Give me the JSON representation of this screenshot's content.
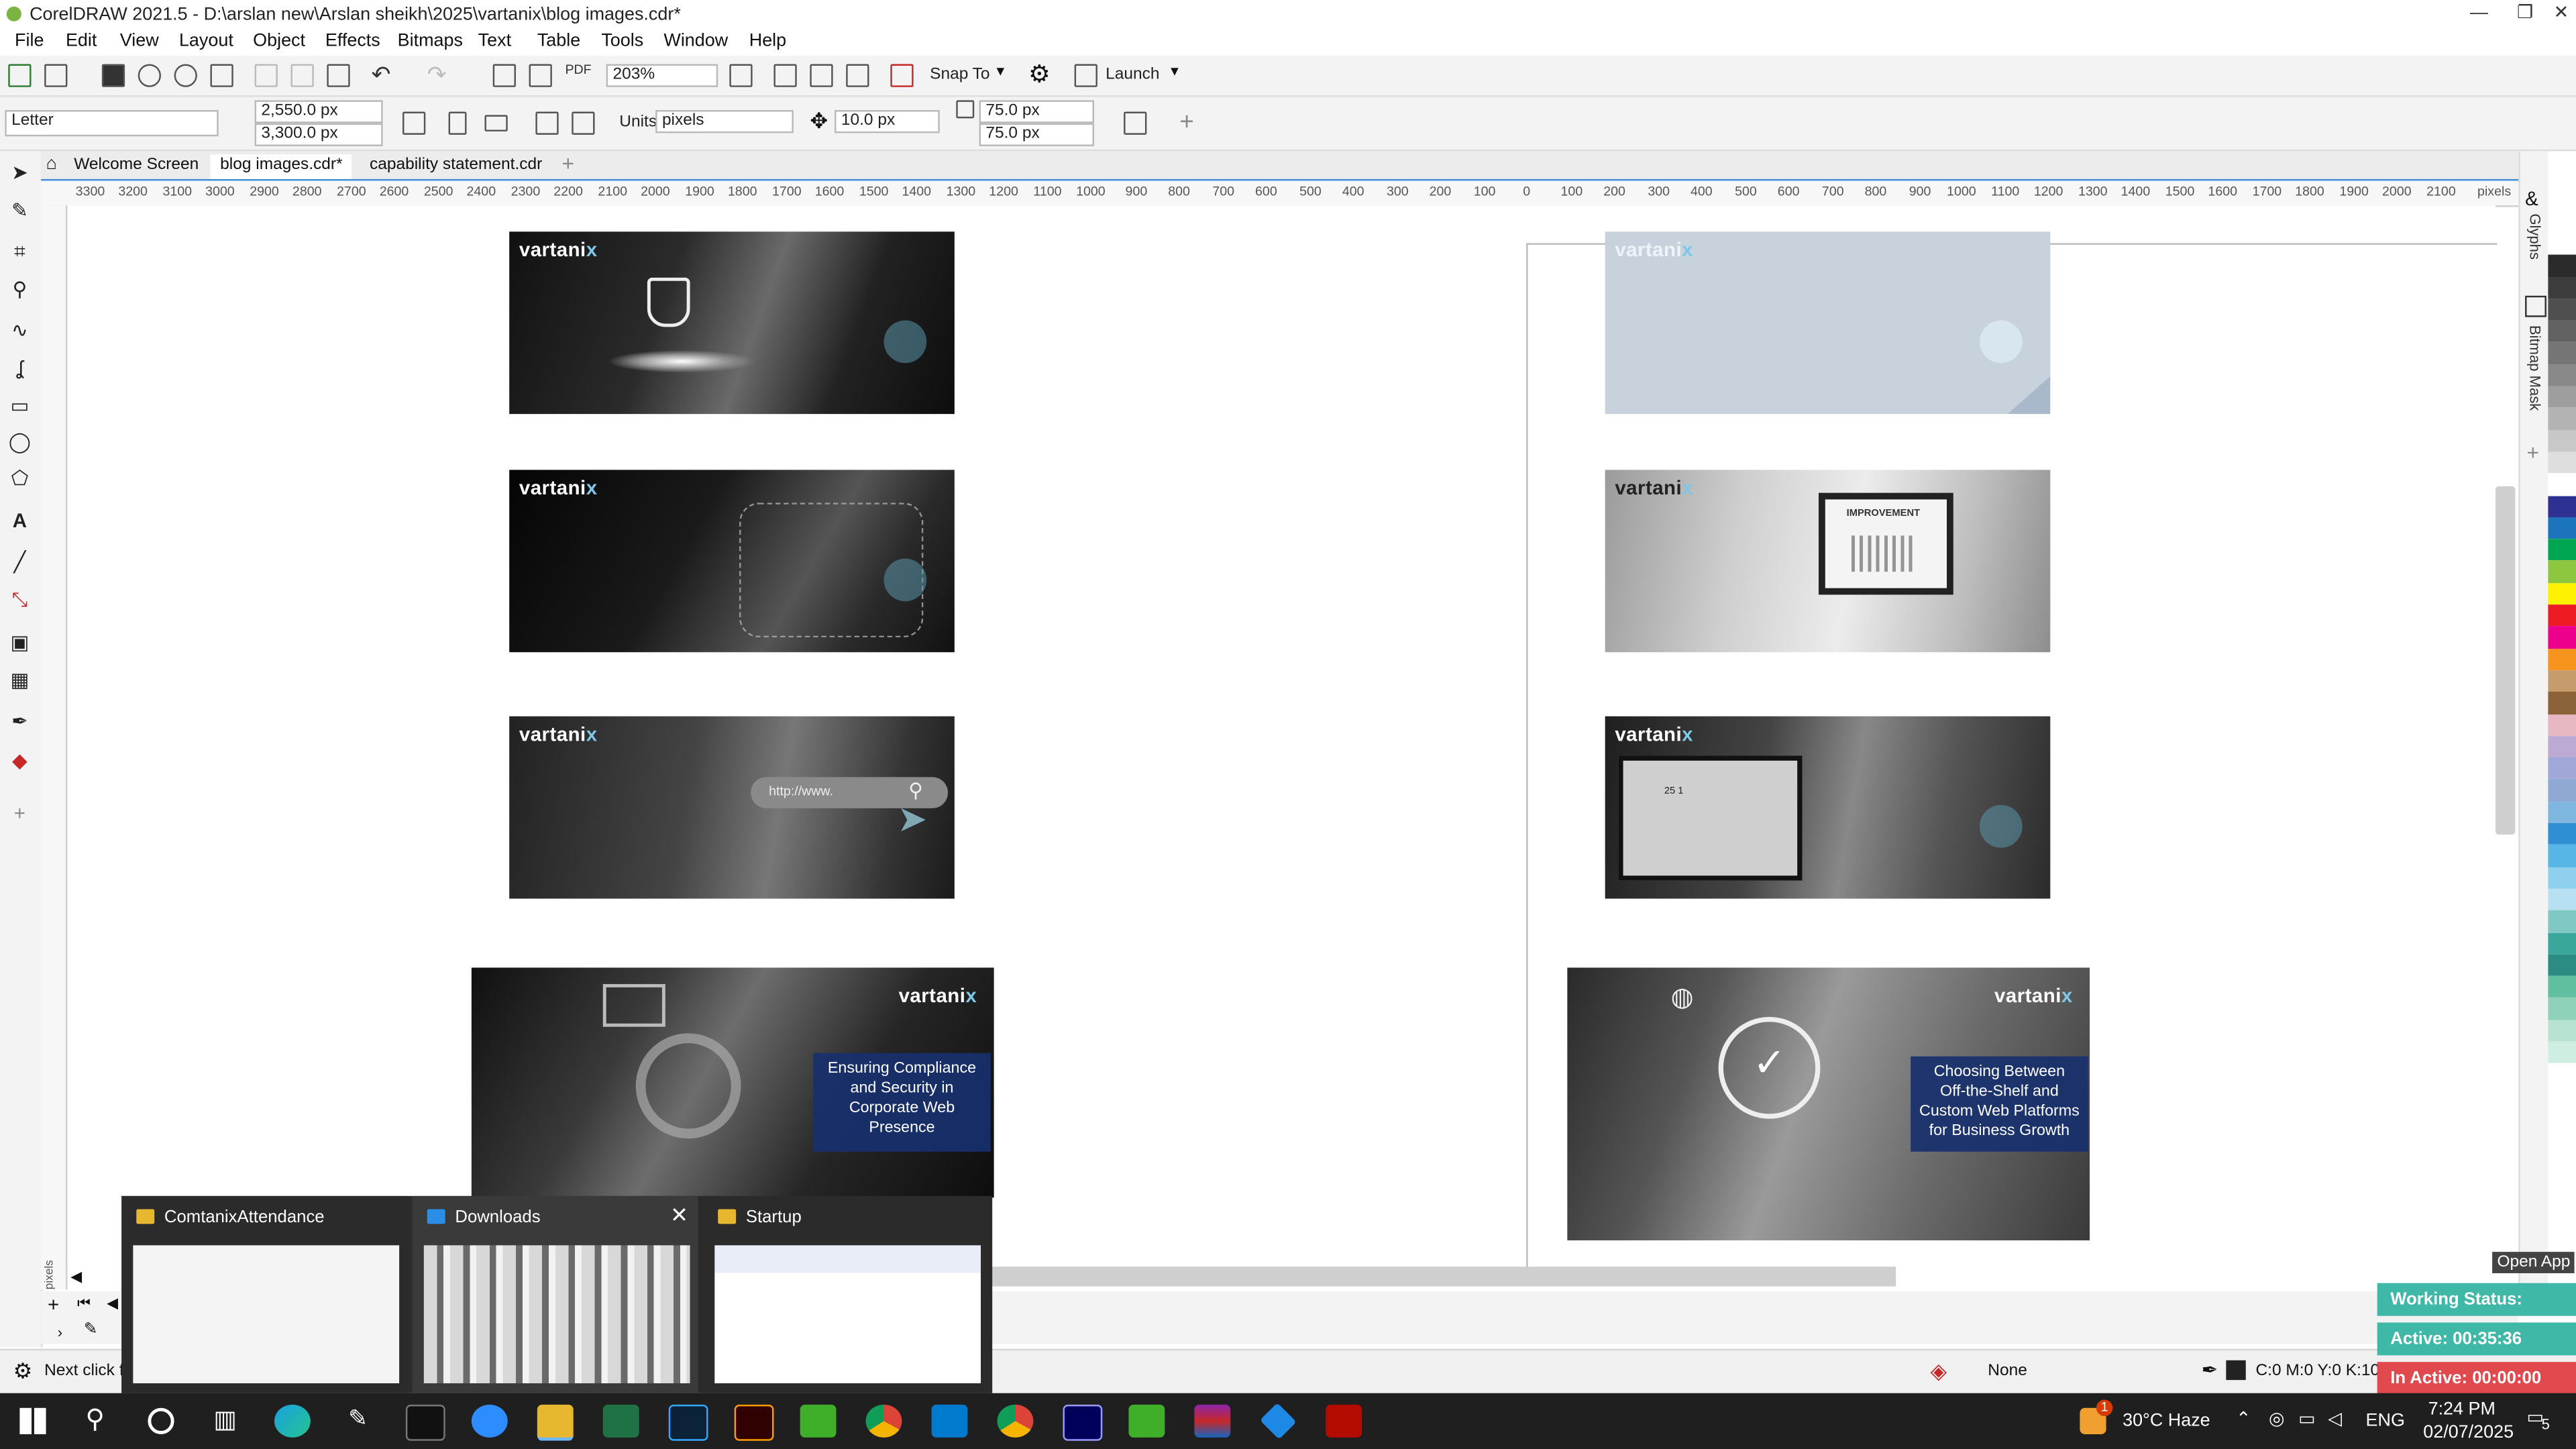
{
  "window": {
    "title": "CorelDRAW 2021.5 - D:\\arslan new\\Arslan sheikh\\2025\\vartanix\\blog images.cdr*",
    "minimize": "—",
    "maximize": "❐",
    "close": "✕"
  },
  "menu": [
    "File",
    "Edit",
    "View",
    "Layout",
    "Object",
    "Effects",
    "Bitmaps",
    "Text",
    "Table",
    "Tools",
    "Window",
    "Help"
  ],
  "toolbar": {
    "zoom": "203%",
    "snap_to": "Snap To",
    "launch": "Launch"
  },
  "property_bar": {
    "page_size": "Letter",
    "width": "2,550.0 px",
    "height": "3,300.0 px",
    "units_label": "Units:",
    "units": "pixels",
    "nudge": "10.0 px",
    "dup_x": "75.0 px",
    "dup_y": "75.0 px"
  },
  "tabs": [
    {
      "label": "Welcome Screen"
    },
    {
      "label": "blog images.cdr*"
    },
    {
      "label": "capability statement.cdr"
    }
  ],
  "ruler": {
    "labels": [
      "3300",
      "3200",
      "3100",
      "3000",
      "2900",
      "2800",
      "2700",
      "2600",
      "2500",
      "2400",
      "2300",
      "2200",
      "2100",
      "2000",
      "1900",
      "1800",
      "1700",
      "1600",
      "1500",
      "1400",
      "1300",
      "1200",
      "1100",
      "1000",
      "900",
      "800",
      "700",
      "600",
      "500",
      "400",
      "300",
      "200",
      "100",
      "0",
      "100",
      "200",
      "300",
      "400",
      "500",
      "600",
      "700",
      "800",
      "900",
      "1000",
      "1100",
      "1200",
      "1300",
      "1400",
      "1500",
      "1600",
      "1700",
      "1800",
      "1900",
      "2000",
      "2100"
    ],
    "unit": "pixels",
    "vertical_unit": "pixels"
  },
  "canvas": {
    "logo_main": "vartani",
    "logo_x": "x",
    "url_text": "http://www.",
    "monitor_text": "IMPROVEMENT",
    "badge_text": "25 1",
    "caption_left": "Ensuring Compliance and Security in Corporate Web Presence",
    "caption_right": "Choosing Between Off-the-Shelf and Custom Web Platforms for Business Growth"
  },
  "dockers": {
    "glyphs": "Glyphs",
    "bitmap_mask": "Bitmap Mask"
  },
  "palette": [
    "#ffffff",
    "#2b2b2b",
    "#3c3c3c",
    "#4f4f4f",
    "#626262",
    "#757575",
    "#898989",
    "#9e9e9e",
    "#b3b3b3",
    "#c8c8c8",
    "#dedede",
    "#ffffff",
    "#2e3192",
    "#1c75bc",
    "#00a651",
    "#8dc63f",
    "#fff200",
    "#ed1c24",
    "#ec008c",
    "#f7941d",
    "#c69c6d",
    "#8c6239",
    "#e7b8c2",
    "#bca9d4",
    "#a1a8d8",
    "#8fa9d3",
    "#7fb6e0",
    "#2f8fd2",
    "#58b6e6",
    "#8ed0ee",
    "#b7e1f2",
    "#7fc8c4",
    "#3aa79d",
    "#2a8c82",
    "#5fbf9f",
    "#8fd2b9",
    "#b9e3d1",
    "#cfeee2"
  ],
  "status": {
    "hint": "Next click fo",
    "fill": "None",
    "outline": "C:0 M:0 Y:0 K:100"
  },
  "thumbnails": [
    {
      "title": "ComtanixAttendance"
    },
    {
      "title": "Downloads"
    },
    {
      "title": "Startup"
    }
  ],
  "widget": {
    "open_app": "Open App",
    "working_status": "Working Status: Active",
    "active": "Active: 00:35:36",
    "inactive": "In Active: 00:00:00"
  },
  "taskbar": {
    "weather": "30°C  Haze",
    "lang": "ENG",
    "time": "7:24 PM",
    "date": "02/07/2025",
    "notif_count": "5",
    "weather_badge": "1"
  }
}
